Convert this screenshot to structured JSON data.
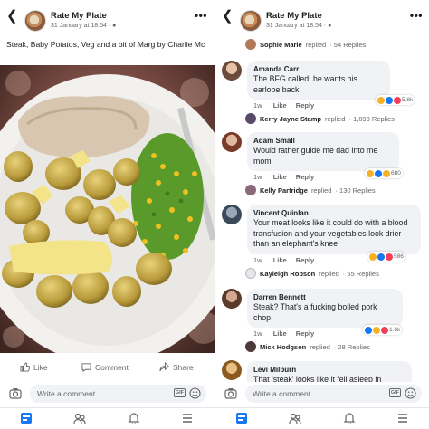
{
  "post": {
    "page_name": "Rate My Plate",
    "timestamp": "31 January at 18:54",
    "caption": "Steak, Baby Potatos, Veg and a bit of Marg by Charlie Mc",
    "actions": {
      "like": "Like",
      "comment": "Comment",
      "share": "Share"
    }
  },
  "composer": {
    "placeholder": "Write a comment...",
    "gif": "GIF"
  },
  "comments_view": {
    "top_reply": {
      "name": "Sophie Marie",
      "action": "replied",
      "count": "54 Replies"
    },
    "comments": [
      {
        "name": "Amanda Carr",
        "text": "The BFG called; he wants his earlobe back",
        "age": "1w",
        "like": "Like",
        "reply": "Reply",
        "reaction_count": "5.8k",
        "reply_summary": {
          "name": "Kerry Jayne Stamp",
          "action": "replied",
          "count": "1,093 Replies"
        }
      },
      {
        "name": "Adam Small",
        "text": "Would rather guide me dad into me mom",
        "age": "1w",
        "like": "Like",
        "reply": "Reply",
        "reaction_count": "680",
        "reply_summary": {
          "name": "Kelly Partridge",
          "action": "replied",
          "count": "130 Replies"
        }
      },
      {
        "name": "Vincent Quinlan",
        "text": "Your meat looks like it could do with a blood transfusion and your vegetables look drier than an elephant's knee",
        "age": "1w",
        "like": "Like",
        "reply": "Reply",
        "reaction_count": "586",
        "reply_summary": {
          "name": "Kayleigh Robson",
          "action": "replied",
          "count": "55 Replies"
        }
      },
      {
        "name": "Darren Bennett",
        "text": "Steak? That's a fucking boiled pork chop.",
        "age": "1w",
        "like": "Like",
        "reply": "Reply",
        "reaction_count": "1.6k",
        "reply_summary": {
          "name": "Mick Hodgson",
          "action": "replied",
          "count": "28 Replies"
        }
      },
      {
        "name": "Levi Milburn",
        "text": "That 'steak' looks like it fell asleep in"
      }
    ]
  },
  "colors": {
    "accent": "#1877f2",
    "bubble": "#f0f2f5",
    "muted": "#65676b"
  },
  "icons": [
    "back-arrow-icon",
    "globe-icon",
    "more-icon",
    "like-icon",
    "comment-icon",
    "share-icon",
    "camera-icon",
    "gif-icon",
    "emoji-icon",
    "feed-icon",
    "groups-icon",
    "notifications-icon",
    "menu-icon"
  ]
}
